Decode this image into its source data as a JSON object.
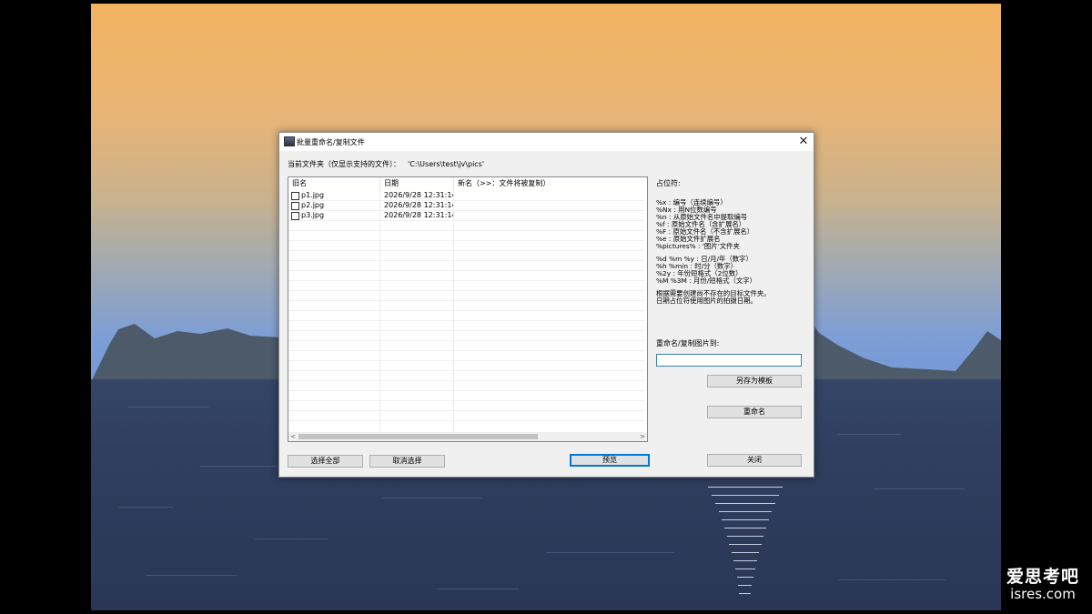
{
  "watermark": {
    "line1": "爱思考吧",
    "line2": "isres.com"
  },
  "dialog": {
    "title": "批量重命名/复制文件",
    "close_glyph": "✕",
    "folder_label": "当前文件夹（仅显示支持的文件）：",
    "folder_path": "'C:\\Users\\test\\jv\\pics'",
    "columns": [
      "旧名",
      "日期",
      "新名（>>：文件将被复制）"
    ],
    "files": [
      {
        "name": "p1.jpg",
        "date": "2026/9/28 12:31:14",
        "new_name": ""
      },
      {
        "name": "p2.jpg",
        "date": "2026/9/28 12:31:14",
        "new_name": ""
      },
      {
        "name": "p3.jpg",
        "date": "2026/9/28 12:31:14",
        "new_name": ""
      }
    ],
    "scroll_left": "<",
    "scroll_right": ">",
    "placeholder_title": "占位符:",
    "placeholder_group1": [
      "%x : 编号（连续编号）",
      "%Nx : 用N位数编号",
      "%n : 从原始文件名中提取编号",
      "%f : 原始文件名（含扩展名）",
      "%F : 原始文件名（不含扩展名）",
      "%e : 原始文件扩展名",
      "%pictures% : '图片'文件夹"
    ],
    "placeholder_group2": [
      "%d %m %y : 日/月/年（数字）",
      "%h %min : 时/分（数字）",
      "%2y : 年份短格式（2位数）",
      "%M %3M : 月份/短格式（文字）"
    ],
    "placeholder_notes": [
      "根据需要创建尚不存在的目标文件夹。",
      "日期占位符使用图片的拍摄日期。"
    ],
    "target_label": "重命名/复制图片到:",
    "target_value": "",
    "buttons": {
      "save_template": "另存为模板",
      "rename": "重命名",
      "select_all": "选择全部",
      "deselect": "取消选择",
      "preview": "预览",
      "close": "关闭"
    }
  }
}
